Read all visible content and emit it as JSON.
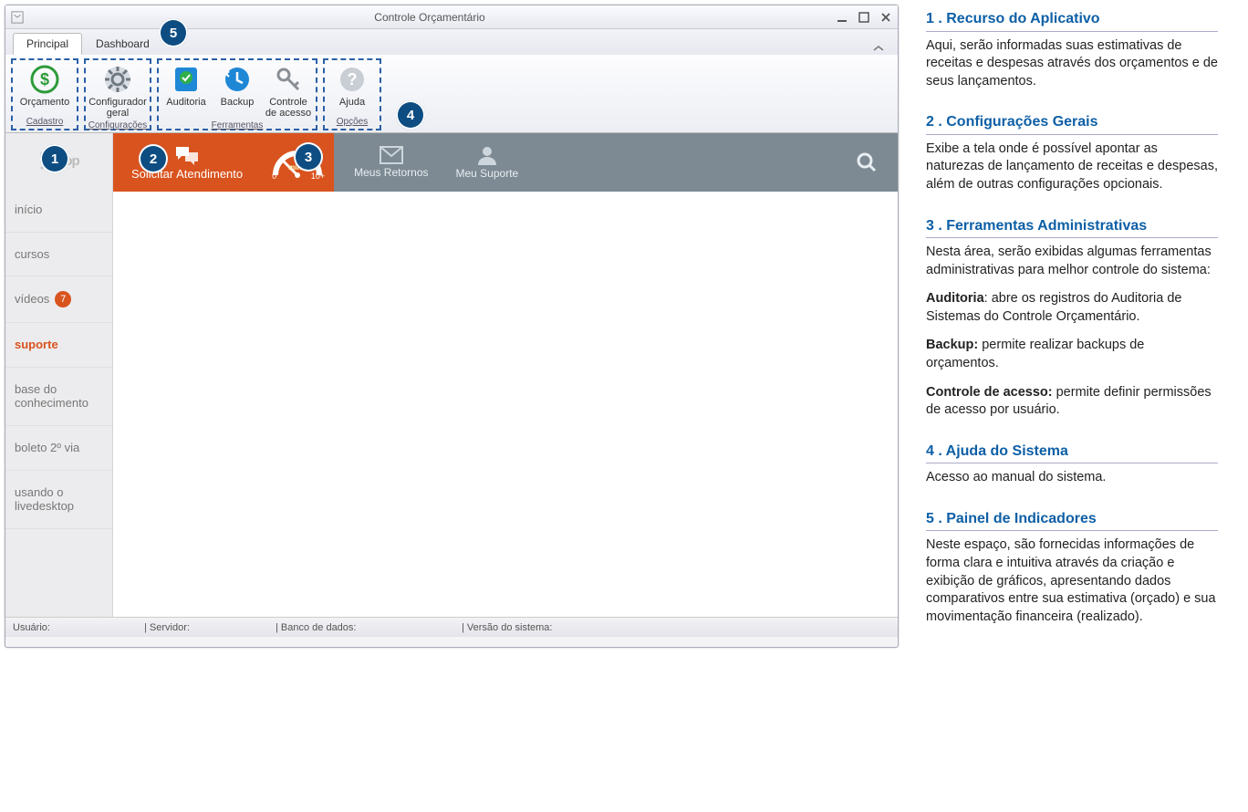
{
  "window": {
    "title": "Controle Orçamentário"
  },
  "ribbon": {
    "tabs": [
      "Principal",
      "Dashboard"
    ],
    "groups": {
      "cadastro": {
        "label": "Cadastro",
        "items": [
          {
            "label": "Orçamento"
          }
        ]
      },
      "configuracoes": {
        "label": "Configurações",
        "items": [
          {
            "label": "Configurador geral"
          }
        ]
      },
      "ferramentas": {
        "label": "Ferramentas",
        "items": [
          {
            "label": "Auditoria"
          },
          {
            "label": "Backup"
          },
          {
            "label": "Controle de acesso"
          }
        ]
      },
      "opcoes": {
        "label": "Opções",
        "items": [
          {
            "label": "Ajuda"
          }
        ]
      }
    }
  },
  "callouts": {
    "c1": "1",
    "c2": "2",
    "c3": "3",
    "c4": "4",
    "c5": "5"
  },
  "sidebar": {
    "logo_text": "top",
    "items": [
      {
        "label": "início"
      },
      {
        "label": "cursos"
      },
      {
        "label": "vídeos",
        "badge": "7"
      },
      {
        "label": "suporte",
        "active": true
      },
      {
        "label": "base do conhecimento"
      },
      {
        "label": "boleto 2º via"
      },
      {
        "label": "usando o livedesktop"
      }
    ]
  },
  "topbar": {
    "solicitar": "Solicitar Atendimento",
    "gauge_min_label": "min",
    "gauge_0": "0",
    "gauge_10": "10+",
    "meus_retornos": "Meus Retornos",
    "meu_suporte": "Meu Suporte"
  },
  "statusbar": {
    "usuario_label": "Usuário:",
    "servidor_label": "| Servidor:",
    "banco_label": "| Banco de dados:",
    "versao_label": "| Versão do sistema:"
  },
  "docs": [
    {
      "num": "1",
      "title": "Recurso do Aplicativo",
      "paragraphs": [
        "Aqui, serão informadas suas estimativas de receitas e despesas através dos orçamentos e de seus lançamentos."
      ]
    },
    {
      "num": "2",
      "title": "Configurações Gerais",
      "paragraphs": [
        "Exibe a tela onde é possível apontar as naturezas de lançamento de receitas e despesas, além de outras configurações opcionais."
      ]
    },
    {
      "num": "3",
      "title": "Ferramentas Administrativas",
      "paragraphs": [
        "Nesta área, serão exibidas algumas ferramentas administrativas para melhor controle do sistema:"
      ],
      "defs": [
        {
          "term": "Auditoria",
          "text": ": abre os registros do Auditoria de Sistemas do Controle Orçamentário."
        },
        {
          "term": "Backup:",
          "text": " permite realizar backups de orçamentos."
        },
        {
          "term": "Controle de acesso:",
          "text": " permite definir permissões de acesso por usuário."
        }
      ]
    },
    {
      "num": "4",
      "title": "Ajuda do Sistema",
      "paragraphs": [
        "Acesso ao manual do sistema."
      ]
    },
    {
      "num": "5",
      "title": "Painel de Indicadores",
      "paragraphs": [
        "Neste espaço, são fornecidas informações de forma clara e intuitiva através da criação e exibição de gráficos, apresentando dados comparativos entre sua estimativa (orçado) e sua movimentação financeira (realizado)."
      ]
    }
  ]
}
